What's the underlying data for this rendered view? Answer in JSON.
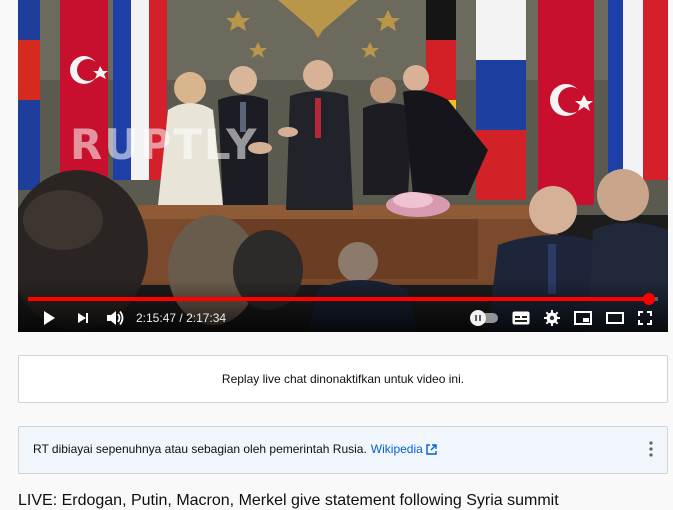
{
  "player": {
    "watermark": "RUPTLY",
    "time_current": "2:15:47",
    "time_total": "2:17:34",
    "time_separator": " / ",
    "progress_fraction": 0.986,
    "progress_color": "#ff0000"
  },
  "chat": {
    "message": "Replay live chat dinonaktifkan untuk video ini."
  },
  "info_panel": {
    "text": "RT dibiayai sepenuhnya atau sebagian oleh pemerintah Rusia.",
    "link_label": "Wikipedia",
    "link_color": "#065fd4"
  },
  "video": {
    "title": "LIVE: Erdogan, Putin, Macron, Merkel give statement following Syria summit"
  }
}
